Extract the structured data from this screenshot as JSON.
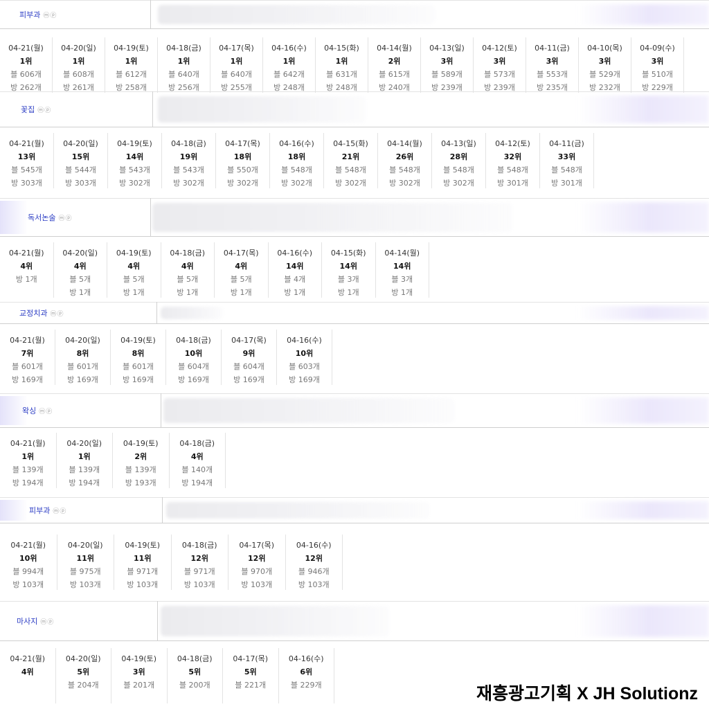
{
  "sections": [
    {
      "keyword": "피부과",
      "mp": "ⓜⓟ",
      "days": [
        {
          "date": "04-21(월)",
          "rank": "1위",
          "blog": "블 606개",
          "cafe": "방 262개"
        },
        {
          "date": "04-20(일)",
          "rank": "1위",
          "blog": "블 608개",
          "cafe": "방 261개"
        },
        {
          "date": "04-19(토)",
          "rank": "1위",
          "blog": "블 612개",
          "cafe": "방 258개"
        },
        {
          "date": "04-18(금)",
          "rank": "1위",
          "blog": "블 640개",
          "cafe": "방 256개"
        },
        {
          "date": "04-17(목)",
          "rank": "1위",
          "blog": "블 640개",
          "cafe": "방 255개"
        },
        {
          "date": "04-16(수)",
          "rank": "1위",
          "blog": "블 642개",
          "cafe": "방 248개"
        },
        {
          "date": "04-15(화)",
          "rank": "1위",
          "blog": "블 631개",
          "cafe": "방 248개"
        },
        {
          "date": "04-14(월)",
          "rank": "2위",
          "blog": "블 615개",
          "cafe": "방 240개"
        },
        {
          "date": "04-13(일)",
          "rank": "3위",
          "blog": "블 589개",
          "cafe": "방 239개"
        },
        {
          "date": "04-12(토)",
          "rank": "3위",
          "blog": "블 573개",
          "cafe": "방 239개"
        },
        {
          "date": "04-11(금)",
          "rank": "3위",
          "blog": "블 553개",
          "cafe": "방 235개"
        },
        {
          "date": "04-10(목)",
          "rank": "3위",
          "blog": "블 529개",
          "cafe": "방 232개"
        },
        {
          "date": "04-09(수)",
          "rank": "3위",
          "blog": "블 510개",
          "cafe": "방 229개"
        }
      ]
    },
    {
      "keyword": "꽃집",
      "mp": "ⓜⓟ",
      "days": [
        {
          "date": "04-21(월)",
          "rank": "13위",
          "blog": "블 545개",
          "cafe": "방 303개"
        },
        {
          "date": "04-20(일)",
          "rank": "15위",
          "blog": "블 544개",
          "cafe": "방 303개"
        },
        {
          "date": "04-19(토)",
          "rank": "14위",
          "blog": "블 543개",
          "cafe": "방 302개"
        },
        {
          "date": "04-18(금)",
          "rank": "19위",
          "blog": "블 543개",
          "cafe": "방 302개"
        },
        {
          "date": "04-17(목)",
          "rank": "18위",
          "blog": "블 550개",
          "cafe": "방 302개"
        },
        {
          "date": "04-16(수)",
          "rank": "18위",
          "blog": "블 548개",
          "cafe": "방 302개"
        },
        {
          "date": "04-15(화)",
          "rank": "21위",
          "blog": "블 548개",
          "cafe": "방 302개"
        },
        {
          "date": "04-14(월)",
          "rank": "26위",
          "blog": "블 548개",
          "cafe": "방 302개"
        },
        {
          "date": "04-13(일)",
          "rank": "28위",
          "blog": "블 548개",
          "cafe": "방 302개"
        },
        {
          "date": "04-12(토)",
          "rank": "32위",
          "blog": "블 548개",
          "cafe": "방 301개"
        },
        {
          "date": "04-11(금)",
          "rank": "33위",
          "blog": "블 548개",
          "cafe": "방 301개"
        }
      ]
    },
    {
      "keyword": "독서논술",
      "mp": "ⓜⓟ",
      "days": [
        {
          "date": "04-21(월)",
          "rank": "4위",
          "blog": "방 1개",
          "cafe": ""
        },
        {
          "date": "04-20(일)",
          "rank": "4위",
          "blog": "블 5개",
          "cafe": "방 1개"
        },
        {
          "date": "04-19(토)",
          "rank": "4위",
          "blog": "블 5개",
          "cafe": "방 1개"
        },
        {
          "date": "04-18(금)",
          "rank": "4위",
          "blog": "블 5개",
          "cafe": "방 1개"
        },
        {
          "date": "04-17(목)",
          "rank": "4위",
          "blog": "블 5개",
          "cafe": "방 1개"
        },
        {
          "date": "04-16(수)",
          "rank": "14위",
          "blog": "블 4개",
          "cafe": "방 1개"
        },
        {
          "date": "04-15(화)",
          "rank": "14위",
          "blog": "블 3개",
          "cafe": "방 1개"
        },
        {
          "date": "04-14(월)",
          "rank": "14위",
          "blog": "블 3개",
          "cafe": "방 1개"
        }
      ]
    },
    {
      "keyword": "교정치과",
      "mp": "ⓜⓟ",
      "days": [
        {
          "date": "04-21(월)",
          "rank": "7위",
          "blog": "블 601개",
          "cafe": "방 169개"
        },
        {
          "date": "04-20(일)",
          "rank": "8위",
          "blog": "블 601개",
          "cafe": "방 169개"
        },
        {
          "date": "04-19(토)",
          "rank": "8위",
          "blog": "블 601개",
          "cafe": "방 169개"
        },
        {
          "date": "04-18(금)",
          "rank": "10위",
          "blog": "블 604개",
          "cafe": "방 169개"
        },
        {
          "date": "04-17(목)",
          "rank": "9위",
          "blog": "블 604개",
          "cafe": "방 169개"
        },
        {
          "date": "04-16(수)",
          "rank": "10위",
          "blog": "블 603개",
          "cafe": "방 169개"
        }
      ]
    },
    {
      "keyword": "왁싱",
      "mp": "ⓜⓟ",
      "days": [
        {
          "date": "04-21(월)",
          "rank": "1위",
          "blog": "블 139개",
          "cafe": "방 194개"
        },
        {
          "date": "04-20(일)",
          "rank": "1위",
          "blog": "블 139개",
          "cafe": "방 194개"
        },
        {
          "date": "04-19(토)",
          "rank": "2위",
          "blog": "블 139개",
          "cafe": "방 193개"
        },
        {
          "date": "04-18(금)",
          "rank": "4위",
          "blog": "블 140개",
          "cafe": "방 194개"
        }
      ]
    },
    {
      "keyword": "피부과",
      "mp": "ⓜⓟ",
      "days": [
        {
          "date": "04-21(월)",
          "rank": "10위",
          "blog": "블 994개",
          "cafe": "방 103개"
        },
        {
          "date": "04-20(일)",
          "rank": "11위",
          "blog": "블 975개",
          "cafe": "방 103개"
        },
        {
          "date": "04-19(토)",
          "rank": "11위",
          "blog": "블 971개",
          "cafe": "방 103개"
        },
        {
          "date": "04-18(금)",
          "rank": "12위",
          "blog": "블 971개",
          "cafe": "방 103개"
        },
        {
          "date": "04-17(목)",
          "rank": "12위",
          "blog": "블 970개",
          "cafe": "방 103개"
        },
        {
          "date": "04-16(수)",
          "rank": "12위",
          "blog": "블 946개",
          "cafe": "방 103개"
        }
      ]
    },
    {
      "keyword": "마사지",
      "mp": "ⓜⓟ",
      "days": [
        {
          "date": "04-21(월)",
          "rank": "4위",
          "blog": "",
          "cafe": ""
        },
        {
          "date": "04-20(일)",
          "rank": "5위",
          "blog": "블 204개",
          "cafe": ""
        },
        {
          "date": "04-19(토)",
          "rank": "3위",
          "blog": "블 201개",
          "cafe": ""
        },
        {
          "date": "04-18(금)",
          "rank": "5위",
          "blog": "블 200개",
          "cafe": ""
        },
        {
          "date": "04-17(목)",
          "rank": "5위",
          "blog": "블 221개",
          "cafe": ""
        },
        {
          "date": "04-16(수)",
          "rank": "6위",
          "blog": "블 229개",
          "cafe": ""
        }
      ]
    }
  ],
  "watermark": "재흥광고기획 X JH Solutionz"
}
